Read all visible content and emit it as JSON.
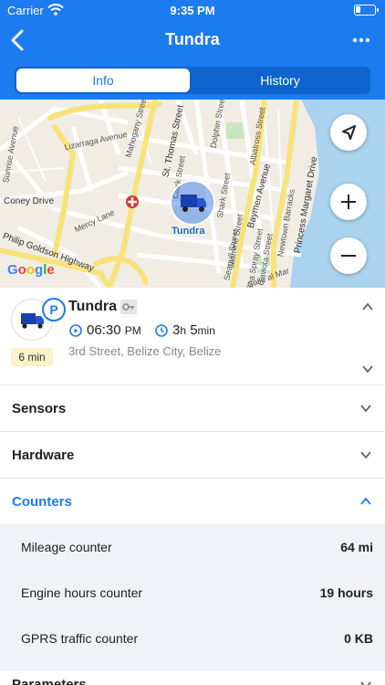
{
  "status_bar": {
    "carrier": "Carrier",
    "time": "9:35 PM"
  },
  "header": {
    "title": "Tundra"
  },
  "tabs": [
    {
      "label": "Info",
      "active": true
    },
    {
      "label": "History",
      "active": false
    }
  ],
  "map": {
    "provider_logo": "Google",
    "marker_label": "Tundra",
    "street_labels": [
      "Lizarraga Avenue",
      "Coney Drive",
      "Mercy Lane",
      "Philip Goldson Highway",
      "St. Thomas Street",
      "Baymen Avenue",
      "Princess Margaret Drive",
      "Newtown Barracks",
      "Calle al Mar",
      "Sunrise Avenue",
      "Seagull Street",
      "Dolphin Street",
      "Mahogany Street",
      "Albatross Street",
      "Jasmine Street",
      "Sea Spray Street",
      "Gaviota Street",
      "Shark Street",
      "Clark Street"
    ]
  },
  "unit": {
    "name": "Tundra",
    "parking_badge": "P",
    "duration_badge": "6 min",
    "time_value": "06:30",
    "time_suffix": "PM",
    "elapsed_h": "3",
    "elapsed_h_unit": "h",
    "elapsed_m": "5",
    "elapsed_m_unit": "min",
    "address": "3rd Street, Belize City, Belize"
  },
  "sections": [
    {
      "label": "Sensors"
    },
    {
      "label": "Hardware"
    },
    {
      "label": "Counters"
    },
    {
      "label": "Parameters"
    }
  ],
  "counters": [
    {
      "label": "Mileage counter",
      "value": "64 mi"
    },
    {
      "label": "Engine hours counter",
      "value": "19 hours"
    },
    {
      "label": "GPRS traffic counter",
      "value": "0 KB"
    }
  ],
  "colors": {
    "accent": "#1d7bf0",
    "header_bg": "#1d7bf0",
    "badge_yellow": "#fbf2c9",
    "counter_bg": "#f1f2f7"
  },
  "icons": [
    "wifi-icon",
    "battery-icon",
    "back-arrow-icon",
    "more-icon",
    "locate-icon",
    "zoom-in-icon",
    "zoom-out-icon",
    "truck-icon",
    "key-icon",
    "play-icon",
    "clock-icon",
    "chevron-up-icon",
    "chevron-down-icon",
    "hospital-icon"
  ]
}
